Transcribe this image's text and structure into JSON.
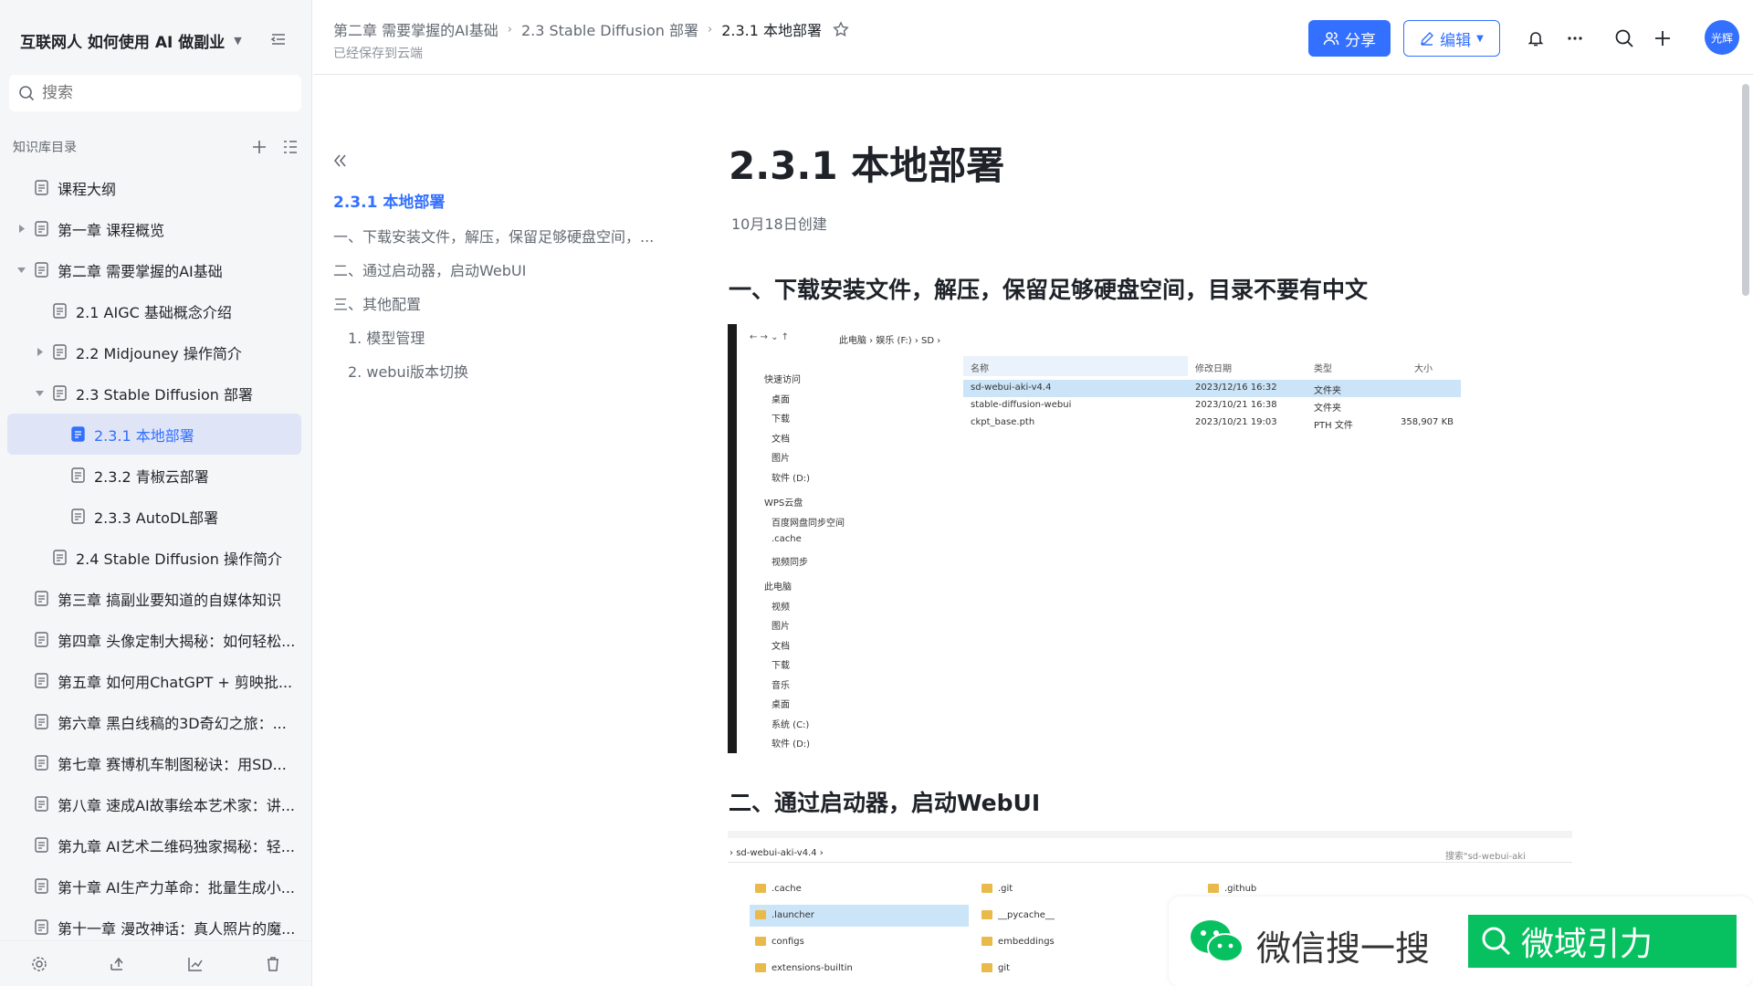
{
  "sidebar": {
    "title": "互联网人 如何使用 AI 做副业",
    "search_placeholder": "搜索",
    "section_label": "知识库目录",
    "items": [
      {
        "label": "课程大纲",
        "level": 0,
        "arrow": "",
        "active": false
      },
      {
        "label": "第一章 课程概览",
        "level": 0,
        "arrow": "right",
        "active": false
      },
      {
        "label": "第二章 需要掌握的AI基础",
        "level": 0,
        "arrow": "down",
        "active": false
      },
      {
        "label": "2.1 AIGC 基础概念介绍",
        "level": 1,
        "arrow": "",
        "active": false
      },
      {
        "label": "2.2 Midjouney 操作简介",
        "level": 1,
        "arrow": "right",
        "active": false
      },
      {
        "label": "2.3 Stable Diffusion 部署",
        "level": 1,
        "arrow": "down",
        "active": false
      },
      {
        "label": "2.3.1 本地部署",
        "level": 2,
        "arrow": "",
        "active": true
      },
      {
        "label": "2.3.2 青椒云部署",
        "level": 2,
        "arrow": "",
        "active": false
      },
      {
        "label": "2.3.3 AutoDL部署",
        "level": 2,
        "arrow": "",
        "active": false
      },
      {
        "label": "2.4 Stable Diffusion 操作简介",
        "level": 1,
        "arrow": "",
        "active": false
      },
      {
        "label": "第三章 搞副业要知道的自媒体知识",
        "level": 0,
        "arrow": "",
        "active": false
      },
      {
        "label": "第四章 头像定制大揭秘：如何轻松...",
        "level": 0,
        "arrow": "",
        "active": false
      },
      {
        "label": "第五章 如何用ChatGPT + 剪映批...",
        "level": 0,
        "arrow": "",
        "active": false
      },
      {
        "label": "第六章 黑白线稿的3D奇幻之旅：...",
        "level": 0,
        "arrow": "",
        "active": false
      },
      {
        "label": "第七章 赛博机车制图秘诀：用SD...",
        "level": 0,
        "arrow": "",
        "active": false
      },
      {
        "label": "第八章 速成AI故事绘本艺术家：讲...",
        "level": 0,
        "arrow": "",
        "active": false
      },
      {
        "label": "第九章 AI艺术二维码独家揭秘：轻...",
        "level": 0,
        "arrow": "",
        "active": false
      },
      {
        "label": "第十章 AI生产力革命：批量生成小...",
        "level": 0,
        "arrow": "",
        "active": false
      },
      {
        "label": "第十一章 漫改神话：真人照片的魔...",
        "level": 0,
        "arrow": "",
        "active": false
      }
    ],
    "footer_icons": [
      "settings-icon",
      "share-out-icon",
      "analytics-icon",
      "trash-icon"
    ]
  },
  "header": {
    "breadcrumb": [
      "第二章 需要掌握的AI基础",
      "2.3 Stable Diffusion 部署",
      "2.3.1 本地部署"
    ],
    "saved_text": "已经保存到云端",
    "share_label": "分享",
    "edit_label": "编辑",
    "avatar_text": "光辉"
  },
  "toc": {
    "items": [
      {
        "label": "2.3.1 本地部署",
        "active": true,
        "sub": false
      },
      {
        "label": "一、下载安装文件，解压，保留足够硬盘空间，...",
        "active": false,
        "sub": false
      },
      {
        "label": "二、通过启动器，启动WebUI",
        "active": false,
        "sub": false
      },
      {
        "label": "三、其他配置",
        "active": false,
        "sub": false
      },
      {
        "label": "1. 模型管理",
        "active": false,
        "sub": true
      },
      {
        "label": "2. webui版本切换",
        "active": false,
        "sub": true
      }
    ]
  },
  "doc": {
    "title": "2.3.1 本地部署",
    "meta": "10月18日创建",
    "h1": "一、下载安装文件，解压，保留足够硬盘空间，目录不要有中文",
    "h2": "二、通过启动器，启动WebUI"
  },
  "explorer1": {
    "path": [
      "此电脑",
      "娱乐 (F:)",
      "SD"
    ],
    "columns": [
      "名称",
      "修改日期",
      "类型",
      "大小"
    ],
    "files": [
      {
        "name": "sd-webui-aki-v4.4",
        "date": "2023/12/16 16:32",
        "type": "文件夹",
        "size": "",
        "selected": true
      },
      {
        "name": "stable-diffusion-webui",
        "date": "2023/10/21 16:38",
        "type": "文件夹",
        "size": "",
        "selected": false
      },
      {
        "name": "ckpt_base.pth",
        "date": "2023/10/21 19:03",
        "type": "PTH 文件",
        "size": "358,907 KB",
        "selected": false
      }
    ],
    "nav": [
      "快速访问",
      "桌面",
      "下载",
      "文档",
      "图片",
      "软件 (D:)",
      "WPS云盘",
      "百度网盘同步空间",
      ".cache",
      "视频同步",
      "此电脑",
      "视频",
      "图片",
      "文档",
      "下载",
      "音乐",
      "桌面",
      "系统 (C:)",
      "软件 (D:)"
    ]
  },
  "explorer2": {
    "path": "sd-webui-aki-v4.4",
    "search_placeholder": "搜索\"sd-webui-aki",
    "col1": [
      ".cache",
      ".launcher",
      "configs",
      "extensions-builtin"
    ],
    "col2": [
      ".git",
      "__pycache__",
      "embeddings",
      "git"
    ],
    "col3": [
      ".github"
    ]
  },
  "watermark": {
    "text": "微信搜一搜",
    "button": "微域引力"
  },
  "colors": {
    "accent": "#3370ff",
    "wechat_green": "#07c160",
    "active_bg": "#dfe4f7"
  }
}
